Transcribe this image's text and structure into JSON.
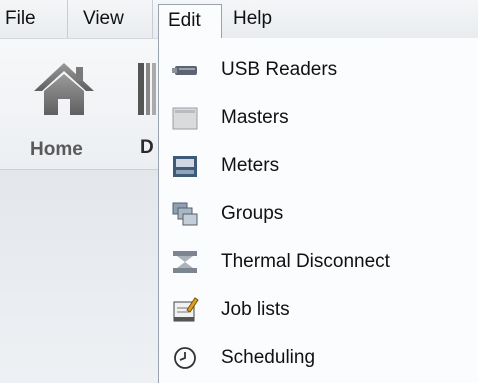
{
  "menubar": {
    "items": [
      "File",
      "View",
      "Edit",
      "Help"
    ]
  },
  "ribbon": {
    "home_label": "Home",
    "partial_label": "D"
  },
  "edit_menu": {
    "items": [
      {
        "label": "USB Readers",
        "icon": "usb-reader-icon"
      },
      {
        "label": "Masters",
        "icon": "masters-icon"
      },
      {
        "label": "Meters",
        "icon": "meters-icon"
      },
      {
        "label": "Groups",
        "icon": "groups-icon"
      },
      {
        "label": "Thermal Disconnect",
        "icon": "thermal-disconnect-icon"
      },
      {
        "label": "Job lists",
        "icon": "job-lists-icon"
      },
      {
        "label": "Scheduling",
        "icon": "clock-icon"
      }
    ]
  }
}
